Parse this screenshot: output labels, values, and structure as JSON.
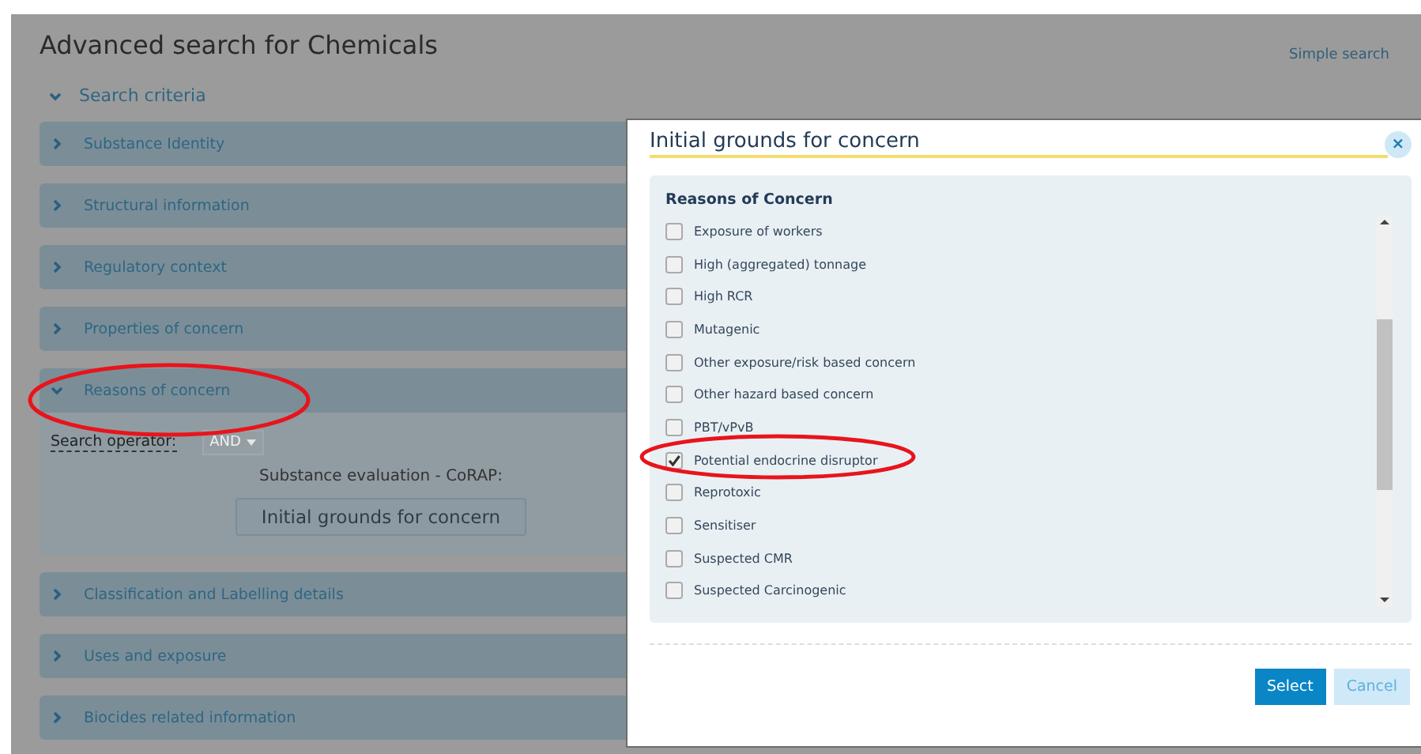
{
  "page": {
    "title": "Advanced search for Chemicals",
    "simple_search_link": "Simple search",
    "search_criteria": {
      "label": "Search criteria",
      "expanded": true
    },
    "sections": [
      {
        "label": "Substance Identity",
        "expanded": false
      },
      {
        "label": "Structural information",
        "expanded": false
      },
      {
        "label": "Regulatory context",
        "expanded": false
      },
      {
        "label": "Properties of concern",
        "expanded": false
      },
      {
        "label": "Reasons of concern",
        "expanded": true,
        "search_operator": {
          "label": "Search operator:",
          "value": "AND"
        },
        "subtitle": "Substance evaluation - CoRAP:",
        "button": "Initial grounds for concern"
      },
      {
        "label": "Classification and Labelling details",
        "expanded": false
      },
      {
        "label": "Uses and exposure",
        "expanded": false
      },
      {
        "label": "Biocides related information",
        "expanded": false
      }
    ]
  },
  "dialog": {
    "title": "Initial grounds for concern",
    "close": "×",
    "panel_title": "Reasons of Concern",
    "options": [
      {
        "label": "Exposure of workers",
        "checked": false
      },
      {
        "label": "High (aggregated) tonnage",
        "checked": false
      },
      {
        "label": "High RCR",
        "checked": false
      },
      {
        "label": "Mutagenic",
        "checked": false
      },
      {
        "label": "Other exposure/risk based concern",
        "checked": false
      },
      {
        "label": "Other hazard based concern",
        "checked": false
      },
      {
        "label": "PBT/vPvB",
        "checked": false
      },
      {
        "label": "Potential endocrine disruptor",
        "checked": true
      },
      {
        "label": "Reprotoxic",
        "checked": false
      },
      {
        "label": "Sensitiser",
        "checked": false
      },
      {
        "label": "Suspected CMR",
        "checked": false
      },
      {
        "label": "Suspected Carcinogenic",
        "checked": false
      }
    ],
    "buttons": [
      {
        "label": "Select",
        "kind": "primary"
      },
      {
        "label": "Cancel",
        "kind": "secondary"
      }
    ]
  }
}
